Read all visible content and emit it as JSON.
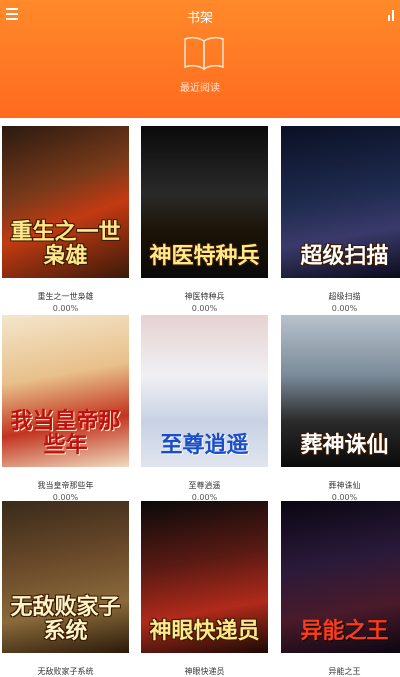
{
  "header": {
    "title": "书架",
    "recent_label": "最近阅读",
    "bg_color": "#ff7b24"
  },
  "books": [
    {
      "name": "重生之一世枭雄",
      "progress": "0.00%",
      "cover_text": "重生之一世枭雄"
    },
    {
      "name": "神医特种兵",
      "progress": "0.00%",
      "cover_text": "神医特种兵"
    },
    {
      "name": "超级扫描",
      "progress": "0.00%",
      "cover_text": "超级扫描"
    },
    {
      "name": "我当皇帝那些年",
      "progress": "0.00%",
      "cover_text": "我当皇帝那些年"
    },
    {
      "name": "至尊逍遥",
      "progress": "0.00%",
      "cover_text": "至尊逍遥"
    },
    {
      "name": "葬神诛仙",
      "progress": "0.00%",
      "cover_text": "葬神诛仙"
    },
    {
      "name": "无敌败家子系统",
      "progress": "",
      "cover_text": "无敌败家子系统"
    },
    {
      "name": "神眼快递员",
      "progress": "",
      "cover_text": "神眼快递员"
    },
    {
      "name": "异能之王",
      "progress": "",
      "cover_text": "异能之王"
    }
  ]
}
